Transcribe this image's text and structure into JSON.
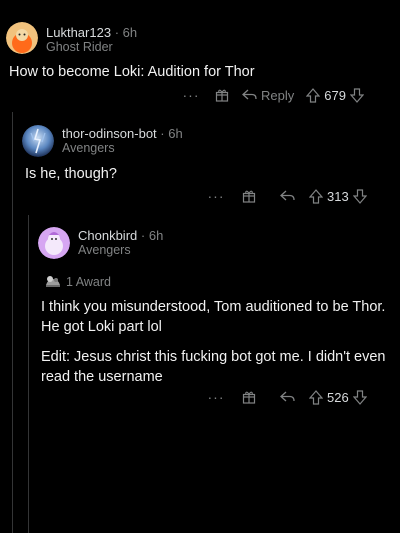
{
  "comments": [
    {
      "author": "Lukthar123",
      "age": "6h",
      "flair": "Ghost Rider",
      "body": [
        "How to become Loki: Audition for Thor"
      ],
      "reply_label": "Reply",
      "score": "679"
    },
    {
      "author": "thor-odinson-bot",
      "age": "6h",
      "flair": "Avengers",
      "body": [
        "Is he, though?"
      ],
      "score": "313"
    },
    {
      "author": "Chonkbird",
      "age": "6h",
      "flair": "Avengers",
      "award": "1 Award",
      "body": [
        "I think you misunderstood, Tom auditioned to be Thor. He got Loki part lol",
        "Edit: Jesus christ this fucking bot got me. I didn't even read the username"
      ],
      "score": "526"
    }
  ],
  "colors": {
    "background": "#000000",
    "text": "#d7dadc",
    "muted": "#818384",
    "thread_line": "#343536"
  },
  "icons": {
    "more": "more-options-icon",
    "award": "gift-award-icon",
    "reply": "reply-arrow-icon",
    "upvote": "upvote-arrow-icon",
    "downvote": "downvote-arrow-icon"
  }
}
